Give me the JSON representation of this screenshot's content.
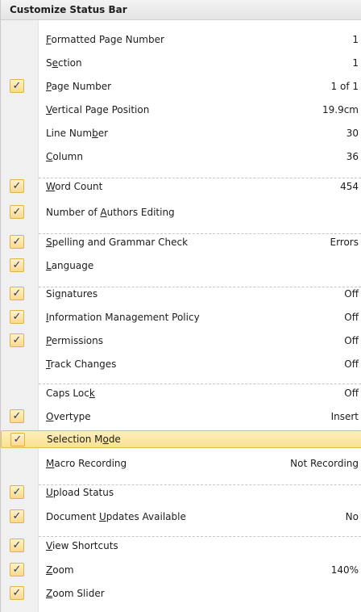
{
  "menu": {
    "title": "Customize Status Bar",
    "items": [
      {
        "label": "Formatted Page Number",
        "u": 0,
        "value": "1",
        "checked": false
      },
      {
        "label": "Section",
        "u": 1,
        "value": "1",
        "checked": false
      },
      {
        "label": "Page Number",
        "u": 0,
        "value": "1 of 1",
        "checked": true
      },
      {
        "label": "Vertical Page Position",
        "u": 0,
        "value": "19.9cm",
        "checked": false
      },
      {
        "label": "Line Number",
        "u": 8,
        "value": "30",
        "checked": false
      },
      {
        "label": "Column",
        "u": 0,
        "value": "36",
        "checked": false
      },
      {
        "label": "Word Count",
        "u": 0,
        "value": "454",
        "checked": true
      },
      {
        "label": "Number of Authors Editing",
        "u": 10,
        "value": "",
        "checked": true
      },
      {
        "label": "Spelling and Grammar Check",
        "u": 0,
        "value": "Errors",
        "checked": true
      },
      {
        "label": "Language",
        "u": 0,
        "value": "",
        "checked": true
      },
      {
        "label": "Signatures",
        "u": 2,
        "value": "Off",
        "checked": true
      },
      {
        "label": "Information Management Policy",
        "u": 0,
        "value": "Off",
        "checked": true
      },
      {
        "label": "Permissions",
        "u": 0,
        "value": "Off",
        "checked": true
      },
      {
        "label": "Track Changes",
        "u": 0,
        "value": "Off",
        "checked": false
      },
      {
        "label": "Caps Lock",
        "u": 8,
        "value": "Off",
        "checked": false
      },
      {
        "label": "Overtype",
        "u": 0,
        "value": "Insert",
        "checked": true
      },
      {
        "label": "Selection Mode",
        "u": 11,
        "value": "",
        "checked": true
      },
      {
        "label": "Macro Recording",
        "u": 0,
        "value": "Not Recording",
        "checked": false
      },
      {
        "label": "Upload Status",
        "u": 0,
        "value": "",
        "checked": true
      },
      {
        "label": "Document Updates Available",
        "u": 9,
        "value": "No",
        "checked": true
      },
      {
        "label": "View Shortcuts",
        "u": 0,
        "value": "",
        "checked": true
      },
      {
        "label": "Zoom",
        "u": 0,
        "value": "140%",
        "checked": true
      },
      {
        "label": "Zoom Slider",
        "u": 0,
        "value": "",
        "checked": true
      }
    ]
  },
  "colors": {
    "highlight_fill": "#fbe092",
    "highlight_border": "#e4bd54",
    "check_fill": "#fbd98a"
  },
  "icons": {
    "check": "checkmark-icon"
  }
}
